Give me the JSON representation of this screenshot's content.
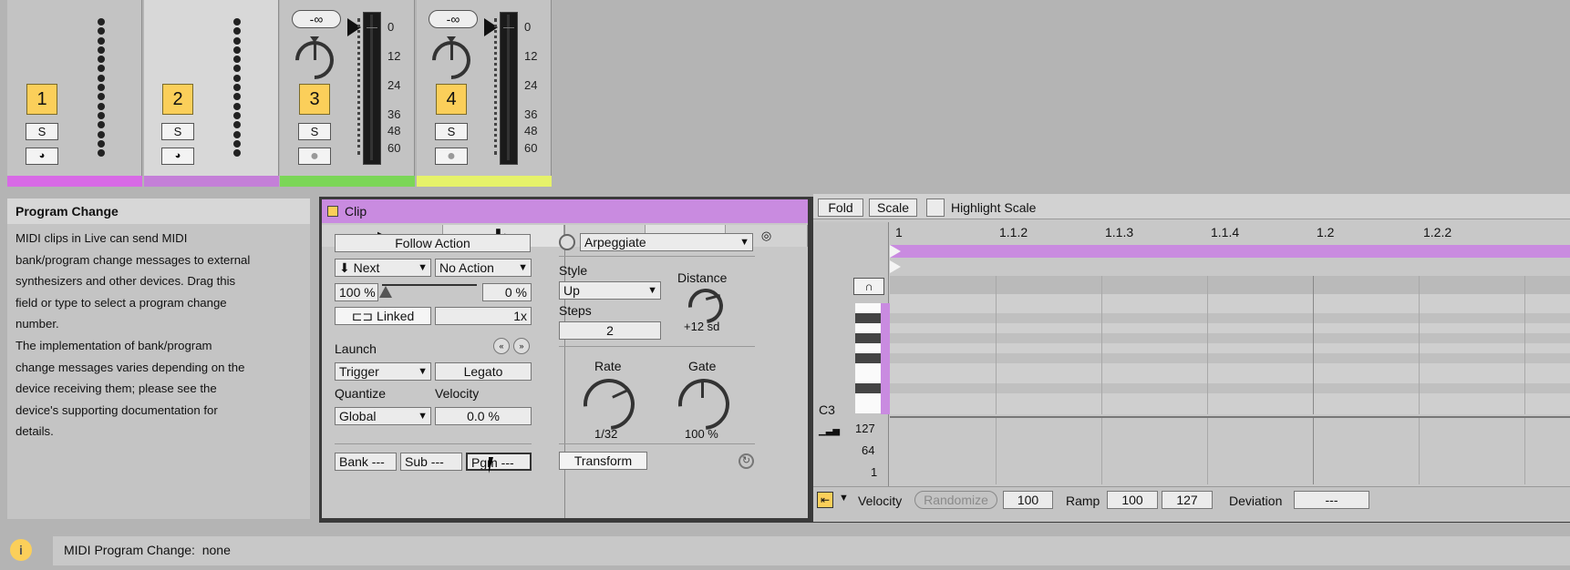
{
  "mixer": {
    "tracks": [
      {
        "number": "1",
        "solo": "S",
        "color": "#d86ae6"
      },
      {
        "number": "2",
        "solo": "S",
        "color": "#c47fd8"
      },
      {
        "number": "3",
        "solo": "S",
        "volume": "-∞",
        "color": "#7bd657"
      },
      {
        "number": "4",
        "solo": "S",
        "volume": "-∞",
        "color": "#e6f26a"
      }
    ],
    "meter_scale": [
      "0",
      "12",
      "24",
      "36",
      "48",
      "60"
    ]
  },
  "info_view": {
    "title": "Program Change",
    "lines": [
      "MIDI clips in Live can send MIDI",
      "bank/program change messages to external",
      "synthesizers and other devices. Drag this",
      "field or type to select a program change",
      "number.",
      "The implementation of bank/program",
      "change messages varies depending on the",
      "device receiving them; please see the",
      "device's supporting documentation for",
      "details."
    ]
  },
  "clip": {
    "title": "Clip",
    "follow_action_label": "Follow Action",
    "follow_action_a": "Next",
    "follow_action_b": "No Action",
    "chance_a": "100 %",
    "chance_b": "0 %",
    "linked_label": "Linked",
    "multiplier": "1x",
    "launch_label": "Launch",
    "launch_mode": "Trigger",
    "legato_label": "Legato",
    "quantize_label": "Quantize",
    "quantize_value": "Global",
    "velocity_label": "Velocity",
    "velocity_value": "0.0 %",
    "bank_label": "Bank ---",
    "sub_label": "Sub ---",
    "pgm_label": "Pgm ---"
  },
  "midi_tools": {
    "tool_name": "Arpeggiate",
    "style_label": "Style",
    "style_value": "Up",
    "distance_label": "Distance",
    "distance_value": "+12 sd",
    "steps_label": "Steps",
    "steps_value": "2",
    "rate_label": "Rate",
    "rate_value": "1/32",
    "gate_label": "Gate",
    "gate_value": "100 %",
    "transform_label": "Transform"
  },
  "note_editor": {
    "fold_label": "Fold",
    "scale_label": "Scale",
    "highlight_label": "Highlight Scale",
    "ruler": [
      "1",
      "1.1.2",
      "1.1.3",
      "1.1.4",
      "1.2",
      "1.2.2"
    ],
    "note_label": "C3",
    "velocity_axis": [
      "127",
      "64",
      "1"
    ],
    "bottom": {
      "velocity_label": "Velocity",
      "randomize_label": "Randomize",
      "velocity_value": "100",
      "ramp_label": "Ramp",
      "ramp_start": "100",
      "ramp_end": "127",
      "deviation_label": "Deviation",
      "deviation_value": "---"
    }
  },
  "status_bar": {
    "text": "MIDI Program Change:  none"
  },
  "colors": {
    "clip_header": "#c98be0",
    "track_yellow": "#fbcf5a",
    "clip_lane": "#c98be0"
  }
}
